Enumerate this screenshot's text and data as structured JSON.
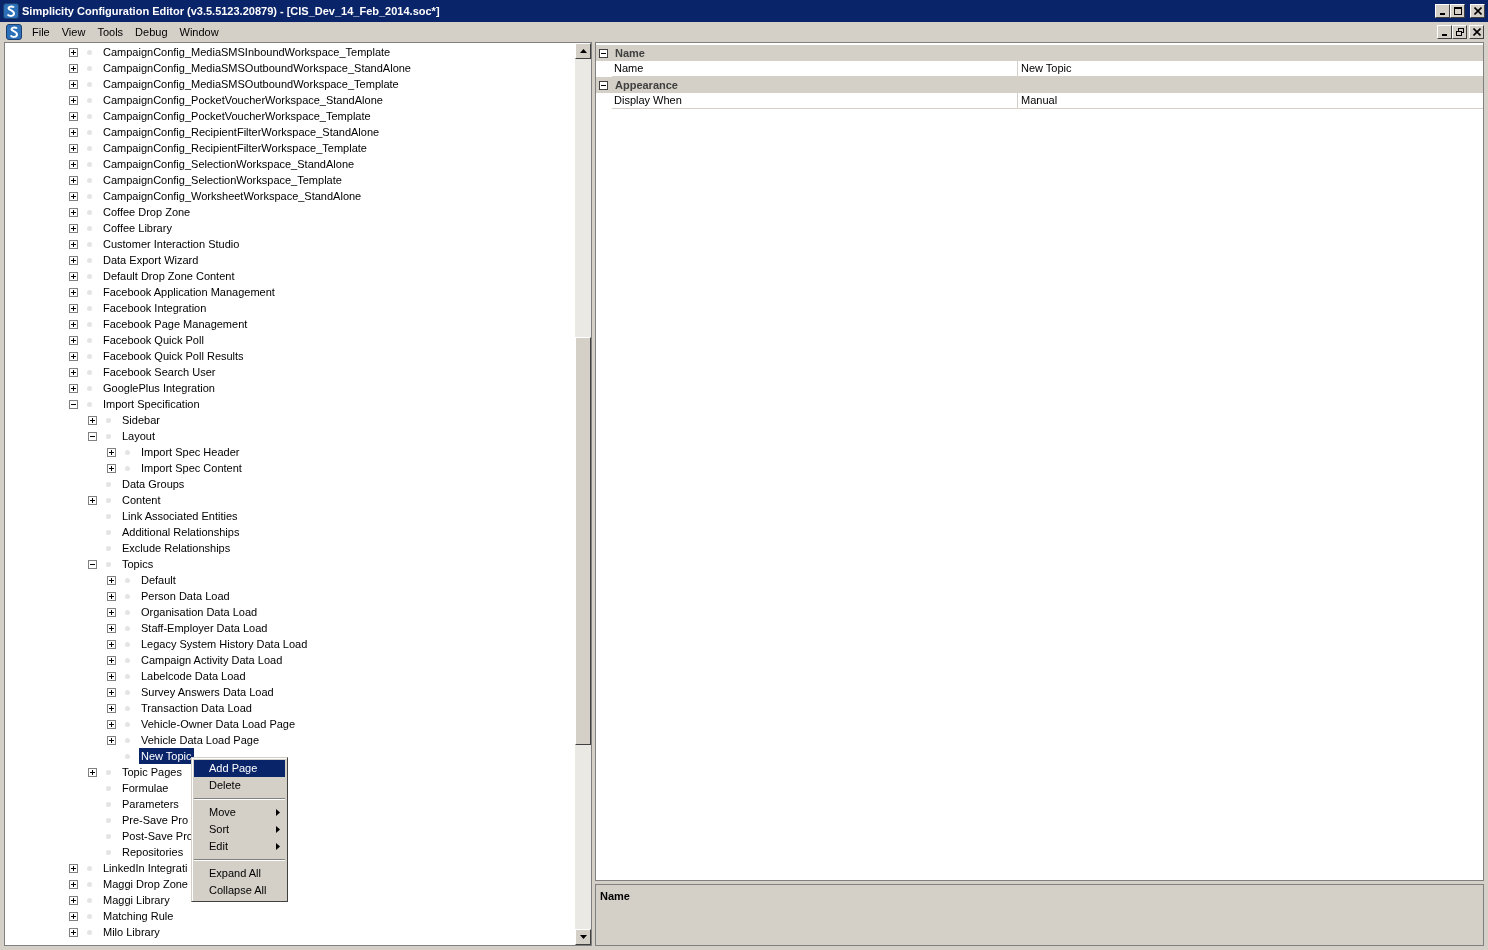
{
  "window": {
    "title": "Simplicity Configuration Editor (v3.5.5123.20879) - [CIS_Dev_14_Feb_2014.soc*]"
  },
  "menu": [
    "File",
    "View",
    "Tools",
    "Debug",
    "Window"
  ],
  "tree": [
    {
      "label": "CampaignConfig_MediaSMSInboundWorkspace_Template",
      "expanded": false,
      "selected": false
    },
    {
      "label": "CampaignConfig_MediaSMSOutboundWorkspace_StandAlone",
      "expanded": false,
      "selected": false
    },
    {
      "label": "CampaignConfig_MediaSMSOutboundWorkspace_Template",
      "expanded": false,
      "selected": false
    },
    {
      "label": "CampaignConfig_PocketVoucherWorkspace_StandAlone",
      "expanded": false,
      "selected": false
    },
    {
      "label": "CampaignConfig_PocketVoucherWorkspace_Template",
      "expanded": false,
      "selected": false
    },
    {
      "label": "CampaignConfig_RecipientFilterWorkspace_StandAlone",
      "expanded": false,
      "selected": false
    },
    {
      "label": "CampaignConfig_RecipientFilterWorkspace_Template",
      "expanded": false,
      "selected": false
    },
    {
      "label": "CampaignConfig_SelectionWorkspace_StandAlone",
      "expanded": false,
      "selected": false
    },
    {
      "label": "CampaignConfig_SelectionWorkspace_Template",
      "expanded": false,
      "selected": false
    },
    {
      "label": "CampaignConfig_WorksheetWorkspace_StandAlone",
      "expanded": false,
      "selected": false
    },
    {
      "label": "Coffee Drop Zone",
      "expanded": false,
      "selected": false
    },
    {
      "label": "Coffee Library",
      "expanded": false,
      "selected": false
    },
    {
      "label": "Customer Interaction Studio",
      "expanded": false,
      "selected": false
    },
    {
      "label": "Data Export Wizard",
      "expanded": false,
      "selected": false
    },
    {
      "label": "Default Drop Zone Content",
      "expanded": false,
      "selected": false
    },
    {
      "label": "Facebook Application Management",
      "expanded": false,
      "selected": false
    },
    {
      "label": "Facebook Integration",
      "expanded": false,
      "selected": false
    },
    {
      "label": "Facebook Page Management",
      "expanded": false,
      "selected": false
    },
    {
      "label": "Facebook Quick Poll",
      "expanded": false,
      "selected": false
    },
    {
      "label": "Facebook Quick Poll Results",
      "expanded": false,
      "selected": false
    },
    {
      "label": "Facebook Search User",
      "expanded": false,
      "selected": false
    },
    {
      "label": "GooglePlus Integration",
      "expanded": false,
      "selected": false
    },
    {
      "label": "Import Specification",
      "expanded": true,
      "selected": false,
      "children": [
        {
          "label": "Sidebar",
          "expanded": false,
          "selected": false
        },
        {
          "label": "Layout",
          "expanded": true,
          "selected": false,
          "children": [
            {
              "label": "Import Spec Header",
              "expanded": false,
              "selected": false
            },
            {
              "label": "Import Spec Content",
              "expanded": false,
              "selected": false
            }
          ]
        },
        {
          "label": "Data Groups",
          "selected": false
        },
        {
          "label": "Content",
          "expanded": false,
          "selected": false
        },
        {
          "label": "Link Associated Entities",
          "selected": false
        },
        {
          "label": "Additional Relationships",
          "selected": false
        },
        {
          "label": "Exclude Relationships",
          "selected": false
        },
        {
          "label": "Topics",
          "expanded": true,
          "selected": false,
          "children": [
            {
              "label": "Default",
              "expanded": false,
              "selected": false
            },
            {
              "label": "Person Data Load",
              "expanded": false,
              "selected": false
            },
            {
              "label": "Organisation Data Load",
              "expanded": false,
              "selected": false
            },
            {
              "label": "Staff-Employer Data Load",
              "expanded": false,
              "selected": false
            },
            {
              "label": "Legacy System History Data Load",
              "expanded": false,
              "selected": false
            },
            {
              "label": "Campaign Activity Data Load",
              "expanded": false,
              "selected": false
            },
            {
              "label": "Labelcode Data Load",
              "expanded": false,
              "selected": false
            },
            {
              "label": "Survey Answers Data Load",
              "expanded": false,
              "selected": false
            },
            {
              "label": "Transaction Data Load",
              "expanded": false,
              "selected": false
            },
            {
              "label": "Vehicle-Owner Data Load Page",
              "expanded": false,
              "selected": false
            },
            {
              "label": "Vehicle Data Load Page",
              "expanded": false,
              "selected": false
            },
            {
              "label": "New Topic",
              "selected": true
            }
          ]
        },
        {
          "label": "Topic Pages",
          "expanded": false,
          "selected": false
        },
        {
          "label": "Formulae",
          "selected": false
        },
        {
          "label": "Parameters",
          "selected": false
        },
        {
          "label": "Pre-Save Pro",
          "selected": false
        },
        {
          "label": "Post-Save Pro",
          "selected": false
        },
        {
          "label": "Repositories",
          "selected": false
        }
      ]
    },
    {
      "label": "LinkedIn Integrati",
      "expanded": false,
      "selected": false
    },
    {
      "label": "Maggi Drop Zone",
      "expanded": false,
      "selected": false
    },
    {
      "label": "Maggi Library",
      "expanded": false,
      "selected": false
    },
    {
      "label": "Matching Rule",
      "expanded": false,
      "selected": false
    },
    {
      "label": "Milo Library",
      "expanded": false,
      "selected": false
    }
  ],
  "context_menu": [
    {
      "kind": "item",
      "label": "Add Page",
      "selected": true
    },
    {
      "kind": "item",
      "label": "Delete",
      "selected": false
    },
    {
      "kind": "separator"
    },
    {
      "kind": "submenu",
      "label": "Move",
      "selected": false
    },
    {
      "kind": "submenu",
      "label": "Sort",
      "selected": false
    },
    {
      "kind": "submenu",
      "label": "Edit",
      "selected": false
    },
    {
      "kind": "separator"
    },
    {
      "kind": "item",
      "label": "Expand All",
      "selected": false
    },
    {
      "kind": "item",
      "label": "Collapse All",
      "selected": false
    }
  ],
  "properties": [
    {
      "category": "Name",
      "expanded": true,
      "rows": [
        {
          "name": "Name",
          "value": "New Topic"
        }
      ]
    },
    {
      "category": "Appearance",
      "expanded": true,
      "rows": [
        {
          "name": "Display When",
          "value": "Manual"
        }
      ]
    }
  ],
  "description": {
    "title": "Name"
  }
}
